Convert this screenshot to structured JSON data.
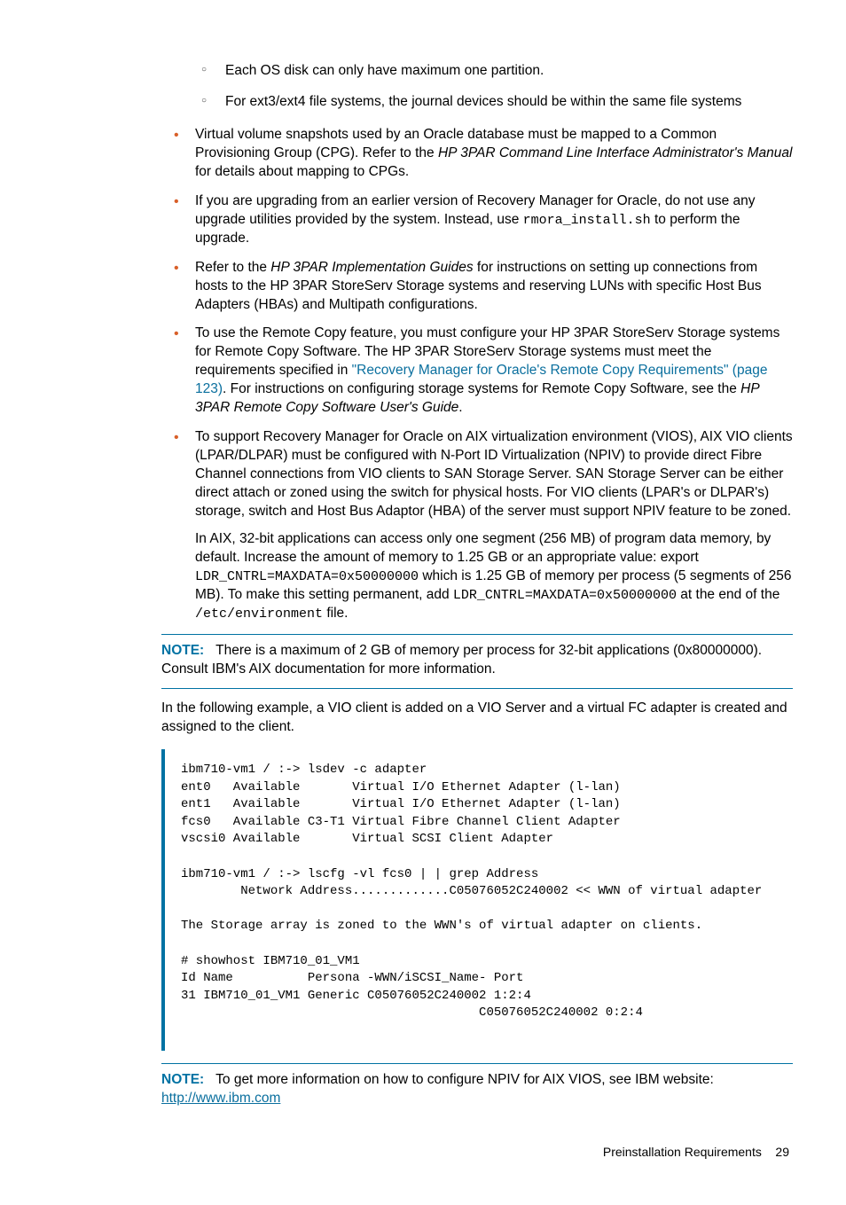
{
  "sub_items": [
    "Each OS disk can only have maximum one partition.",
    "For ext3/ext4 file systems, the journal devices should be within the same file systems"
  ],
  "bullets": {
    "b1_a": "Virtual volume snapshots used by an Oracle database must be mapped to a Common Provisioning Group (CPG). Refer to the ",
    "b1_i": "HP 3PAR Command Line Interface Administrator's Manual",
    "b1_b": " for details about mapping to CPGs.",
    "b2_a": "If you are upgrading from an earlier version of Recovery Manager for Oracle, do not use any upgrade utilities provided by the system. Instead, use ",
    "b2_code": "rmora_install.sh",
    "b2_b": " to perform the upgrade.",
    "b3_a": "Refer to the ",
    "b3_i": "HP 3PAR Implementation Guides",
    "b3_b": " for instructions on setting up connections from hosts to the HP 3PAR StoreServ Storage systems and reserving LUNs with specific Host Bus Adapters (HBAs) and Multipath configurations.",
    "b4_a": "To use the Remote Copy feature, you must configure your HP 3PAR StoreServ Storage systems for Remote Copy Software. The HP 3PAR StoreServ Storage systems must meet the requirements specified in ",
    "b4_link": "\"Recovery Manager for Oracle's Remote Copy Requirements\" (page 123)",
    "b4_b": ". For instructions on configuring storage systems for Remote Copy Software, see the ",
    "b4_i": "HP 3PAR Remote Copy Software User's Guide",
    "b4_c": ".",
    "b5": "To support Recovery Manager for Oracle on AIX virtualization environment (VIOS), AIX VIO clients (LPAR/DLPAR) must be configured with N-Port ID Virtualization (NPIV) to provide direct Fibre Channel connections from VIO clients to SAN Storage Server. SAN Storage Server can be either direct attach or zoned using the switch for physical hosts. For VIO clients (LPAR's or DLPAR's) storage, switch and Host Bus Adaptor (HBA) of the server must support NPIV feature to be zoned.",
    "b5_p2_a": "In AIX, 32-bit applications can access only one segment (256 MB) of program data memory, by default. Increase the amount of memory to 1.25 GB or an appropriate value: export ",
    "b5_p2_c1": "LDR_CNTRL=MAXDATA=0x50000000",
    "b5_p2_b": " which is 1.25 GB of memory per process (5 segments of 256 MB). To make this setting permanent, add ",
    "b5_p2_c2": "LDR_CNTRL=MAXDATA=0x50000000",
    "b5_p2_c": " at the end of the ",
    "b5_p2_c3": "/etc/environment",
    "b5_p2_d": " file."
  },
  "note1_label": "NOTE:",
  "note1_text": "There is a maximum of 2 GB of memory per process for 32-bit applications (0x80000000). Consult IBM's AIX documentation for more information.",
  "after_note1": "In the following example, a VIO client is added on a VIO Server and a virtual FC adapter is created and assigned to the client.",
  "code_block": "ibm710-vm1 / :-> lsdev -c adapter\nent0   Available       Virtual I/O Ethernet Adapter (l-lan)\nent1   Available       Virtual I/O Ethernet Adapter (l-lan)\nfcs0   Available C3-T1 Virtual Fibre Channel Client Adapter\nvscsi0 Available       Virtual SCSI Client Adapter\n\nibm710-vm1 / :-> lscfg -vl fcs0 | | grep Address\n        Network Address.............C05076052C240002 << WWN of virtual adapter\n\nThe Storage array is zoned to the WWN's of virtual adapter on clients.\n\n# showhost IBM710_01_VM1\nId Name          Persona -WWN/iSCSI_Name- Port\n31 IBM710_01_VM1 Generic C05076052C240002 1:2:4\n                                        C05076052C240002 0:2:4",
  "note2_label": "NOTE:",
  "note2_text": "To get more information on how to configure NPIV for AIX VIOS, see IBM website: ",
  "note2_link": "http://www.ibm.com",
  "footer_text": "Preinstallation Requirements",
  "footer_page": "29"
}
